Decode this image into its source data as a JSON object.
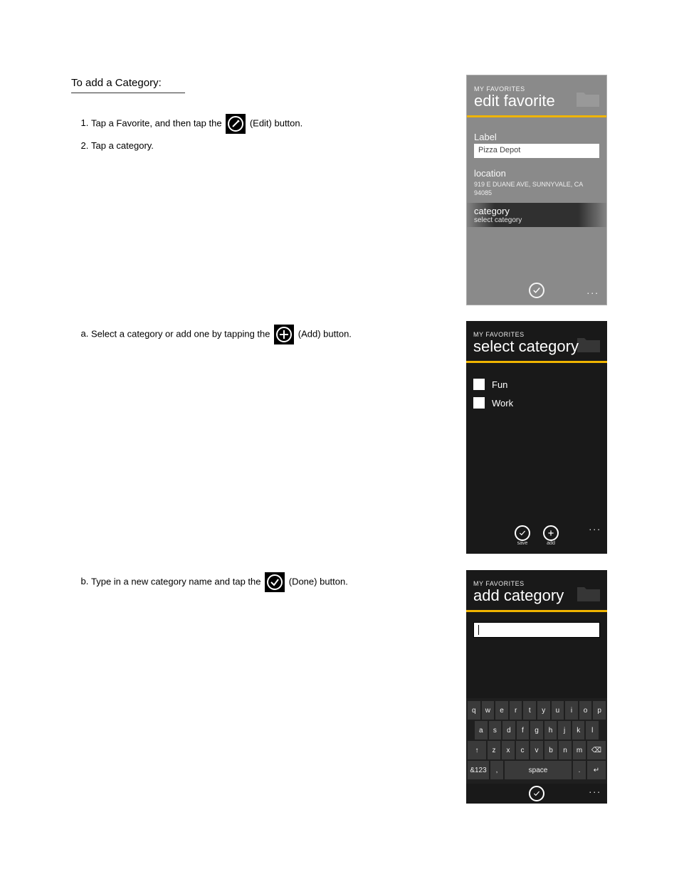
{
  "left": {
    "section_heading": "To add a Category:",
    "block1": {
      "li1_pre": "Tap a Favorite, and then tap the ",
      "li1_iconname": "edit-icon",
      "li1_post": " (Edit) button.",
      "li2": "Tap a category."
    },
    "block2": {
      "li1_pre": "Select a category or add one by tapping the ",
      "li1_post": " (Add) button."
    },
    "block3": {
      "li1_pre": "Type in a new category name and tap the ",
      "li1_post": " (Done) button."
    }
  },
  "screen1": {
    "app": "MY FAVORITES",
    "title": "edit favorite",
    "label_label": "Label",
    "label_value": "Pizza Depot",
    "location_label": "location",
    "location_value": "919 E DUANE AVE, SUNNYVALE, CA 94085",
    "category_label": "category",
    "category_value": "select category",
    "more": "..."
  },
  "screen2": {
    "app": "MY FAVORITES",
    "title": "select category",
    "items": {
      "0": "Fun",
      "1": "Work"
    },
    "save": "save",
    "add": "add",
    "more": "..."
  },
  "screen3": {
    "app": "MY FAVORITES",
    "title": "add category",
    "input_value": "",
    "more": "...",
    "keys_r1": {
      "0": "q",
      "1": "w",
      "2": "e",
      "3": "r",
      "4": "t",
      "5": "y",
      "6": "u",
      "7": "i",
      "8": "o",
      "9": "p"
    },
    "keys_r2": {
      "0": "a",
      "1": "s",
      "2": "d",
      "3": "f",
      "4": "g",
      "5": "h",
      "6": "j",
      "7": "k",
      "8": "l"
    },
    "keys_r3": {
      "shift": "↑",
      "0": "z",
      "1": "x",
      "2": "c",
      "3": "v",
      "4": "b",
      "5": "n",
      "6": "m",
      "back": "⌫"
    },
    "keys_r4": {
      "sym": "&123",
      "comma": ",",
      "space": "space",
      "dot": ".",
      "enter": "↵"
    }
  }
}
